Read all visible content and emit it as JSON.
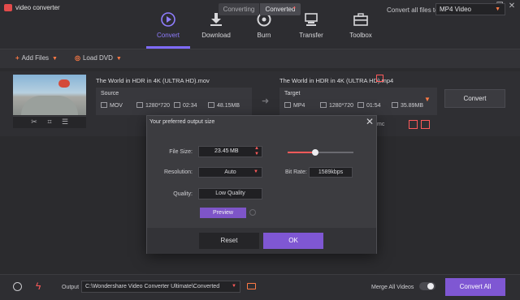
{
  "app": {
    "title": "video converter"
  },
  "window_controls": {
    "minimize": "–",
    "restore": "❐",
    "close": "✕"
  },
  "nav": {
    "items": [
      {
        "label": "Convert",
        "icon": "play-circle-icon",
        "active": true
      },
      {
        "label": "Download",
        "icon": "download-icon",
        "active": false
      },
      {
        "label": "Burn",
        "icon": "disc-icon",
        "active": false
      },
      {
        "label": "Transfer",
        "icon": "transfer-icon",
        "active": false
      },
      {
        "label": "Toolbox",
        "icon": "toolbox-icon",
        "active": false
      }
    ]
  },
  "toolbar": {
    "add_files": "Add Files",
    "load_dvd": "Load DVD",
    "tabs": {
      "converting": "Converting",
      "converted": "Converted"
    },
    "convert_all_to_label": "Convert all files to:",
    "format_selected": "MP4 Video"
  },
  "file": {
    "source_name": "The World in HDR in 4K (ULTRA HD).mov",
    "target_name": "The World in HDR in 4K (ULTRA HD).mp4",
    "source": {
      "heading": "Source",
      "format": "MOV",
      "resolution": "1280*720",
      "duration": "02:34",
      "size": "48.15MB"
    },
    "target": {
      "heading": "Target",
      "format": "MP4",
      "resolution": "1280*720",
      "duration": "01:54",
      "size": "35.89MB"
    },
    "convert_label": "Convert",
    "behind_partial_text": "mc"
  },
  "dialog": {
    "title": "Your preferred output size",
    "file_size_label": "File Size:",
    "file_size_value": "23.45",
    "file_size_unit": "MB",
    "resolution_label": "Resolution:",
    "resolution_value": "Auto",
    "quality_label": "Quality:",
    "quality_value": "Low Quality",
    "bitrate_label": "Bit Rate:",
    "bitrate_value": "1589kbps",
    "size_slider_fraction": 0.42,
    "preview_label": "Preview",
    "reset_label": "Reset",
    "ok_label": "OK"
  },
  "bottom": {
    "output_label": "Output",
    "output_path": "C:\\Wondershare Video Converter Ultimate\\Converted",
    "merge_label": "Merge All Videos",
    "merge_enabled": false,
    "convert_all_label": "Convert All"
  },
  "colors": {
    "accent": "#7f57d3",
    "nav_active": "#8f7dff",
    "highlight": "#ff5a5a",
    "background": "#2b2b2e"
  }
}
